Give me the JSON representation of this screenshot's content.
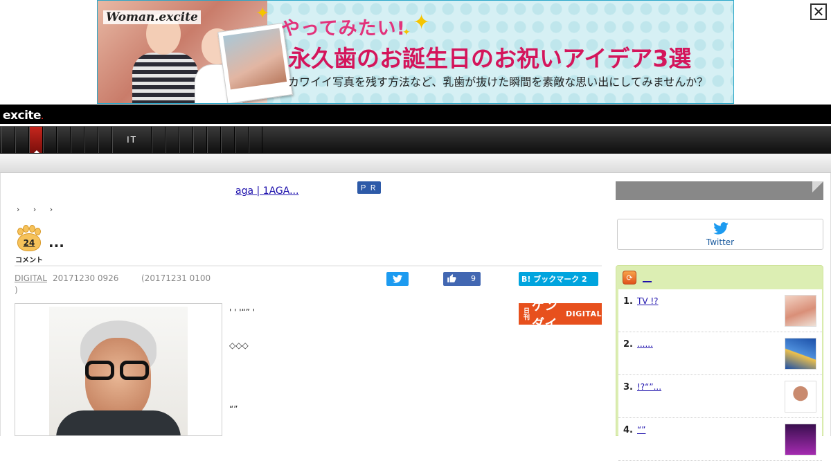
{
  "banner": {
    "brand": "Woman.excite",
    "line1": "やってみたい!",
    "line2": "永久歯のお誕生日のお祝いアイデア3選",
    "line3": "カワイイ写真を残す方法など、乳歯が抜けた瞬間を素敵な思い出にしてみませんか？",
    "close_label": "✕"
  },
  "site": {
    "logo": "excite",
    "logo_dot": "."
  },
  "nav": {
    "items": [
      "",
      "",
      "",
      "",
      "",
      "",
      "",
      "",
      "IT",
      "",
      "",
      "",
      "",
      "",
      "",
      "",
      ""
    ]
  },
  "promo": {
    "link_text": "aga  | 1AGA...           ",
    "badge": "ＰＲ"
  },
  "breadcrumb": "› › ›",
  "article": {
    "comment_count": "24",
    "comment_label": "コメント",
    "title": "...",
    "source": "DIGITAL",
    "posted": "20171230 0926",
    "updated": "(20171231 0100",
    "updated_close": ")",
    "like_count": "9",
    "hatena_label": "B! ブックマーク 2",
    "publisher_logo_small": "日刊",
    "publisher_logo_main": "ゲンダイ",
    "publisher_logo_suffix": "DIGITAL",
    "paragraphs": [
      "'      '                 '“”                                      '",
      "◇◇◇",
      "“”"
    ]
  },
  "sidebar": {
    "twitter_label": "Twitter",
    "ranking_title": "__",
    "ranking": [
      {
        "num": "1.",
        "title": "TV !?      "
      },
      {
        "num": "2.",
        "title": "......                 "
      },
      {
        "num": "3.",
        "title": "!?“”...             "
      },
      {
        "num": "4.",
        "title": " “”        "
      }
    ]
  },
  "colors": {
    "accent_red": "#c6261d",
    "twitter": "#1d9bf0",
    "facebook": "#4267b2",
    "hatena": "#00a4de",
    "ranking_bg": "#dceeb3"
  }
}
